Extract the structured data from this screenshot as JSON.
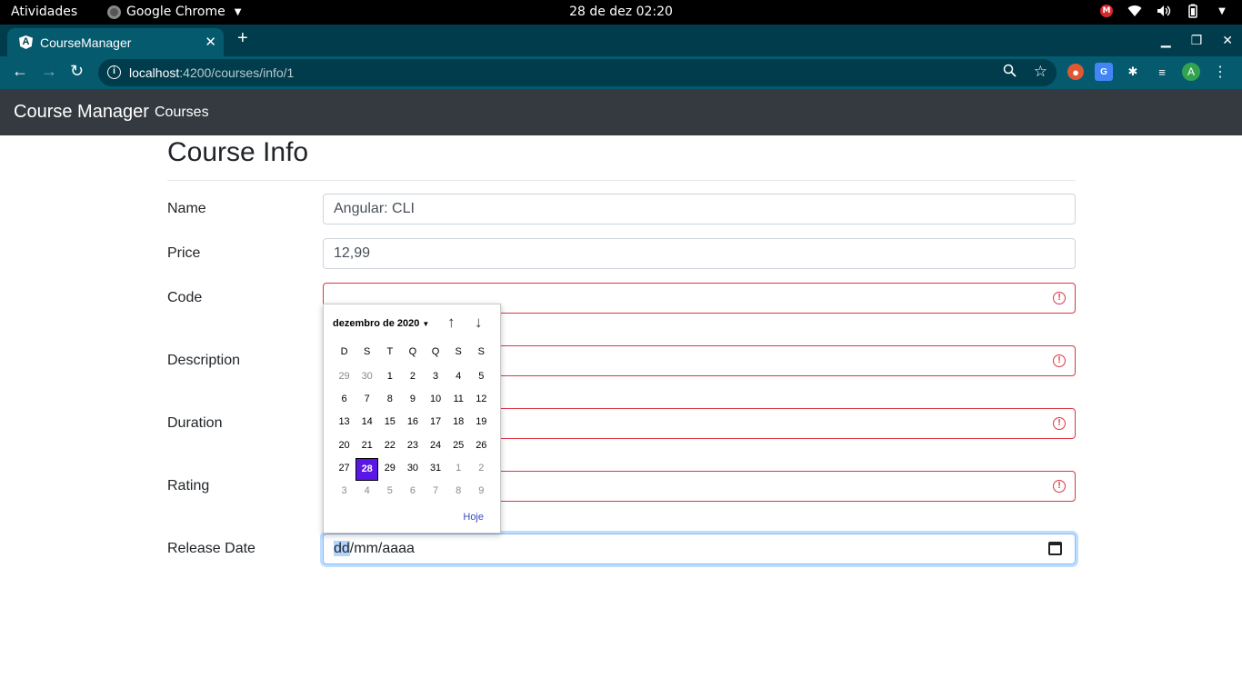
{
  "os": {
    "activities": "Atividades",
    "app_name": "Google Chrome",
    "clock": "28 de dez  02:20"
  },
  "browser": {
    "tab_title": "CourseManager",
    "url_host": "localhost",
    "url_path": ":4200/courses/info/1",
    "avatar_letter": "A"
  },
  "navbar": {
    "brand": "Course Manager",
    "link_courses": "Courses"
  },
  "form": {
    "title": "Course Info",
    "name_label": "Name",
    "name_value": "Angular: CLI",
    "price_label": "Price",
    "price_value": "12,99",
    "code_label": "Code",
    "description_label": "Description",
    "duration_label": "Duration",
    "rating_label": "Rating",
    "release_label": "Release Date",
    "release_dd": "dd",
    "release_rest": "/mm/aaaa"
  },
  "datepicker": {
    "month_label": "dezembro de 2020",
    "weekdays": [
      "D",
      "S",
      "T",
      "Q",
      "Q",
      "S",
      "S"
    ],
    "days": [
      {
        "d": "29",
        "muted": true
      },
      {
        "d": "30",
        "muted": true
      },
      {
        "d": "1"
      },
      {
        "d": "2"
      },
      {
        "d": "3"
      },
      {
        "d": "4"
      },
      {
        "d": "5"
      },
      {
        "d": "6"
      },
      {
        "d": "7"
      },
      {
        "d": "8"
      },
      {
        "d": "9"
      },
      {
        "d": "10"
      },
      {
        "d": "11"
      },
      {
        "d": "12"
      },
      {
        "d": "13"
      },
      {
        "d": "14"
      },
      {
        "d": "15"
      },
      {
        "d": "16"
      },
      {
        "d": "17"
      },
      {
        "d": "18"
      },
      {
        "d": "19"
      },
      {
        "d": "20"
      },
      {
        "d": "21"
      },
      {
        "d": "22"
      },
      {
        "d": "23"
      },
      {
        "d": "24"
      },
      {
        "d": "25"
      },
      {
        "d": "26"
      },
      {
        "d": "27"
      },
      {
        "d": "28",
        "selected": true
      },
      {
        "d": "29"
      },
      {
        "d": "30"
      },
      {
        "d": "31"
      },
      {
        "d": "1",
        "muted": true
      },
      {
        "d": "2",
        "muted": true
      },
      {
        "d": "3",
        "muted": true
      },
      {
        "d": "4",
        "muted": true
      },
      {
        "d": "5",
        "muted": true
      },
      {
        "d": "6",
        "muted": true
      },
      {
        "d": "7",
        "muted": true
      },
      {
        "d": "8",
        "muted": true
      },
      {
        "d": "9",
        "muted": true
      }
    ],
    "today_label": "Hoje"
  },
  "colors": {
    "navbar_bg": "#343a40",
    "invalid_border": "#dc3545",
    "selected_day": "#5b17e6",
    "chrome_frame": "#003c4c"
  }
}
